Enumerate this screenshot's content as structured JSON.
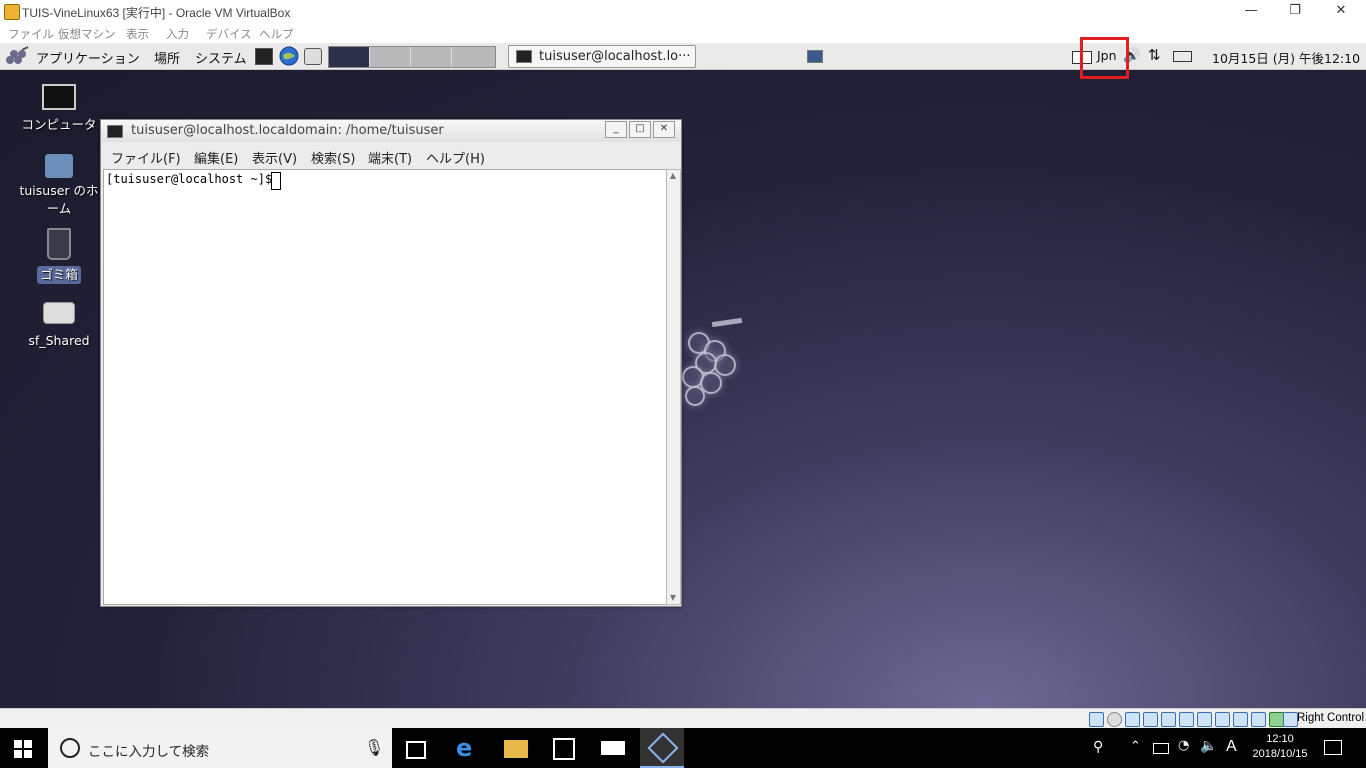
{
  "host_window": {
    "title": "TUIS-VineLinux63 [実行中] - Oracle VM VirtualBox",
    "minimize": "—",
    "maximize": "❐",
    "close": "✕",
    "menu": [
      "ファイル",
      "仮想マシン",
      "表示",
      "入力",
      "デバイス",
      "ヘルプ"
    ]
  },
  "guest_panel": {
    "menus": [
      "アプリケーション",
      "場所",
      "システム"
    ],
    "task_button": "tuisuser@localhost.lo···",
    "keyboard_layout": "Jpn",
    "clock": "10月15日 (月) 午後12:10"
  },
  "desktop_icons": [
    {
      "label": "コンピュータ"
    },
    {
      "label": "tuisuser のホーム"
    },
    {
      "label": "ゴミ箱"
    },
    {
      "label": "sf_Shared"
    }
  ],
  "terminal": {
    "title": "tuisuser@localhost.localdomain: /home/tuisuser",
    "menu": [
      "ファイル(F)",
      "編集(E)",
      "表示(V)",
      "検索(S)",
      "端末(T)",
      "ヘルプ(H)"
    ],
    "prompt": "[tuisuser@localhost ~]$"
  },
  "vbox_status": {
    "host_key": "Right Control"
  },
  "windows_taskbar": {
    "search_placeholder": "ここに入力して検索",
    "ime": "A",
    "time": "12:10",
    "date": "2018/10/15"
  }
}
